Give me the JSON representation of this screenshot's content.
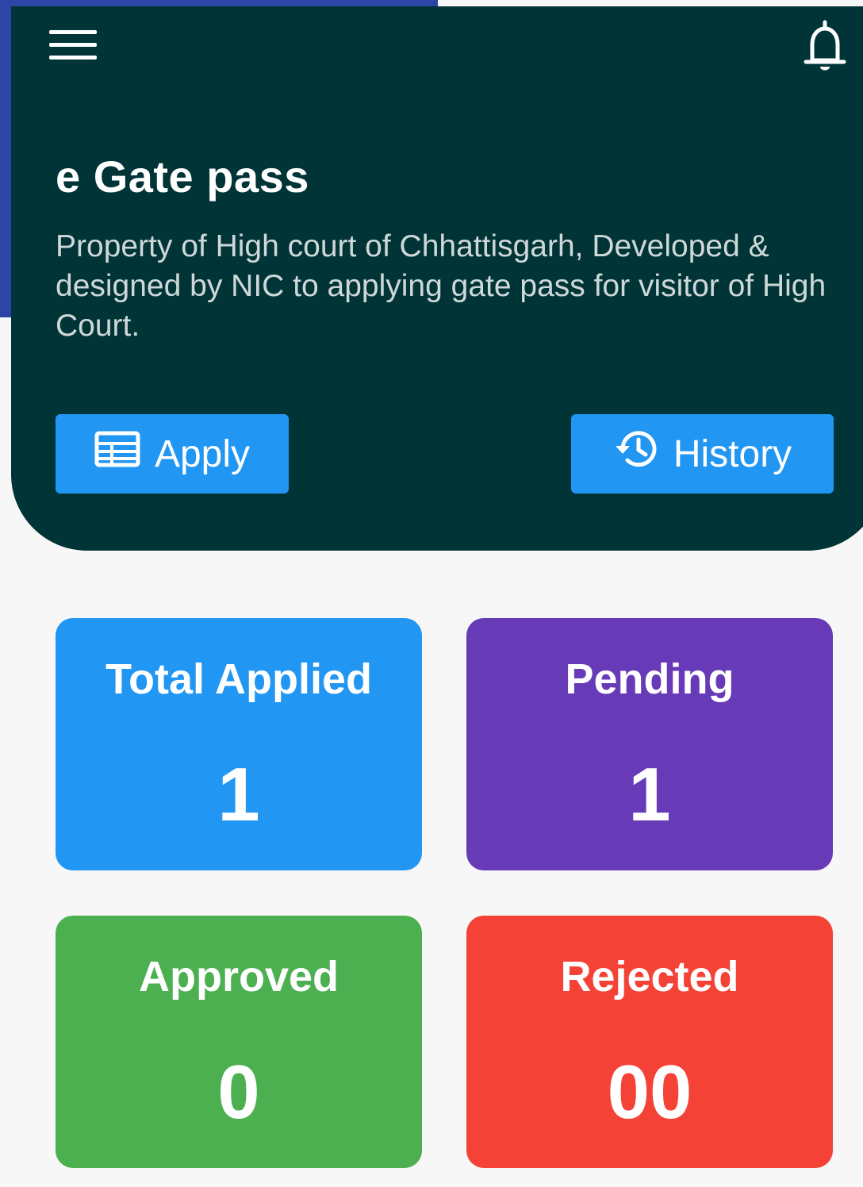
{
  "app": {
    "title": "e Gate pass",
    "description": "Property of High court of Chhattisgarh, Developed & designed by NIC to applying gate pass for visitor of High Court."
  },
  "header": {
    "menu_icon": "hamburger-menu-icon",
    "notification_icon": "bell-icon",
    "background_color": "#013437"
  },
  "actions": {
    "apply": {
      "label": "Apply",
      "icon": "form-table-icon"
    },
    "history": {
      "label": "History",
      "icon": "history-clock-icon"
    }
  },
  "stats": {
    "total_applied": {
      "label": "Total Applied",
      "value": "1",
      "color": "#2196f3"
    },
    "pending": {
      "label": "Pending",
      "value": "1",
      "color": "#673ab7"
    },
    "approved": {
      "label": "Approved",
      "value": "0",
      "color": "#4caf50"
    },
    "rejected": {
      "label": "Rejected",
      "value": "00",
      "color": "#f44336"
    }
  }
}
